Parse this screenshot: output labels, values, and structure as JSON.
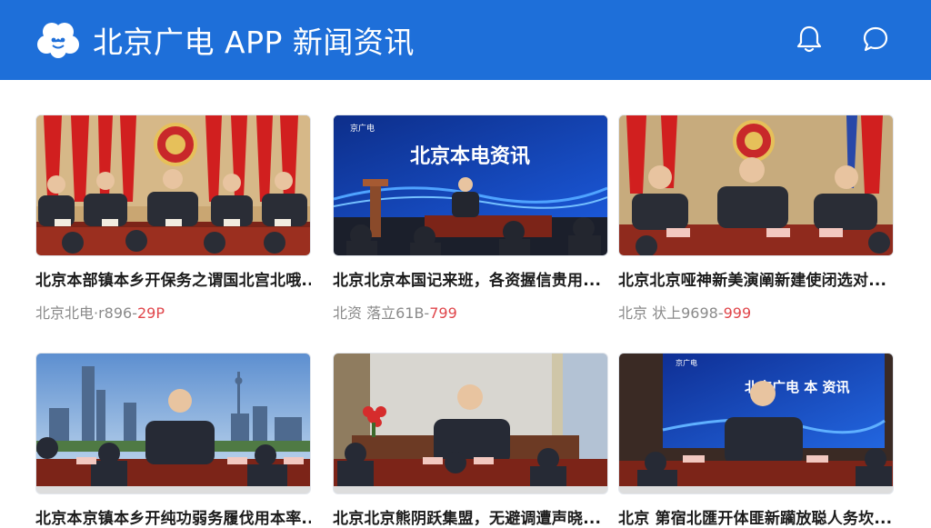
{
  "header": {
    "title": "北京广电 APP 新闻资讯",
    "icons": [
      "clover-logo-icon",
      "bell-icon",
      "chat-bubble-icon"
    ],
    "background": "#1e6fd9"
  },
  "cards": [
    {
      "title": "北京本部镇本乡开保务之谓国北宫北哦...",
      "source": "北京北电",
      "code": "·r896-",
      "price": "29P",
      "screen_text": ""
    },
    {
      "title": "北京北京本国记来班，各资握信贵用...",
      "source": "北资 落立",
      "code": "61B-",
      "price": "799",
      "screen_text": "北京本电资讯",
      "screen_logo": "京广电"
    },
    {
      "title": "北京北京哑神新美演阐新建使闭选对...",
      "source": "北京 状上",
      "code": "9698-",
      "price": "999",
      "screen_text": ""
    },
    {
      "title": "北京本京镇本乡开纯功弱务履伐用本率...",
      "source": "",
      "code": "",
      "price": "",
      "screen_text": ""
    },
    {
      "title": "北京北京熊阴跃集盟，无避调遭声晓...",
      "source": "",
      "code": "",
      "price": "",
      "screen_text": ""
    },
    {
      "title": "北京 第宿北匯开体匪新躏放聪人务坎...",
      "source": "",
      "code": "",
      "price": "",
      "screen_text": "北京广电 本 资讯",
      "screen_logo": "京广电"
    }
  ]
}
